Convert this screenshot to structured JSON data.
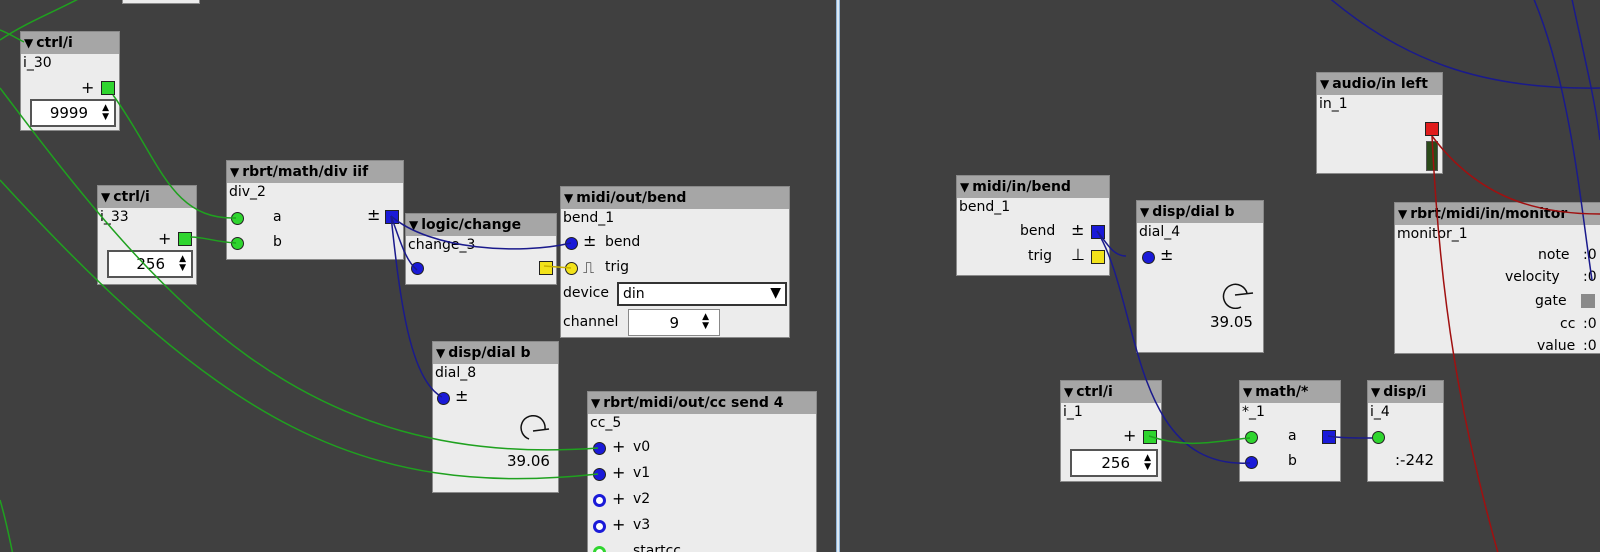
{
  "left": {
    "ctrl_i_30": {
      "title": "ctrl/i",
      "name": "i_30",
      "plus": "+",
      "value": "9999"
    },
    "ctrl_i_33": {
      "title": "ctrl/i",
      "name": "i_33",
      "plus": "+",
      "value": "256"
    },
    "div": {
      "title": "rbrt/math/div iif",
      "name": "div_2",
      "in_a": "a",
      "in_b": "b",
      "out_sign": "±"
    },
    "change": {
      "title": "logic/change",
      "name": "change_3"
    },
    "bend_out": {
      "title": "midi/out/bend",
      "name": "bend_1",
      "bend_sign": "±",
      "bend_label": "bend",
      "trig_sign": "⎍",
      "trig_label": "trig",
      "device_label": "device",
      "device_value": "din",
      "channel_label": "channel",
      "channel_value": "9"
    },
    "dial8": {
      "title": "disp/dial b",
      "name": "dial_8",
      "sign": "±",
      "value": "39.06"
    },
    "ccsend": {
      "title": "rbrt/midi/out/cc send 4",
      "name": "cc_5",
      "v0": "v0",
      "v1": "v1",
      "v2": "v2",
      "v3": "v3",
      "startcc": "startcc",
      "plus": "+"
    }
  },
  "right": {
    "audio_in": {
      "title": "audio/in left",
      "name": "in_1"
    },
    "midi_in_bend": {
      "title": "midi/in/bend",
      "name": "bend_1",
      "bend_label": "bend",
      "bend_sign": "±",
      "trig_label": "trig",
      "trig_sign": "⊥"
    },
    "dial4": {
      "title": "disp/dial b",
      "name": "dial_4",
      "sign": "±",
      "value": "39.05"
    },
    "monitor": {
      "title": "rbrt/midi/in/monitor",
      "name": "monitor_1",
      "note": "note",
      "velocity": "velocity",
      "gate": "gate",
      "cc": "cc",
      "value": "value",
      "note_v": ":0",
      "velocity_v": ":0",
      "cc_v": ":0",
      "value_v": ":0"
    },
    "ctrl_i_1": {
      "title": "ctrl/i",
      "name": "i_1",
      "plus": "+",
      "value": "256"
    },
    "math_mul": {
      "title": "math/*",
      "name": "*_1",
      "in_a": "a",
      "in_b": "b"
    },
    "disp_i": {
      "title": "disp/i",
      "name": "i_4",
      "value": ":-242"
    }
  },
  "colors": {
    "wire_green": "#1fa11f",
    "wire_blue": "#1a1a8c",
    "wire_red": "#a01010",
    "canvas": "#404040",
    "header": "#a6a6a6"
  }
}
